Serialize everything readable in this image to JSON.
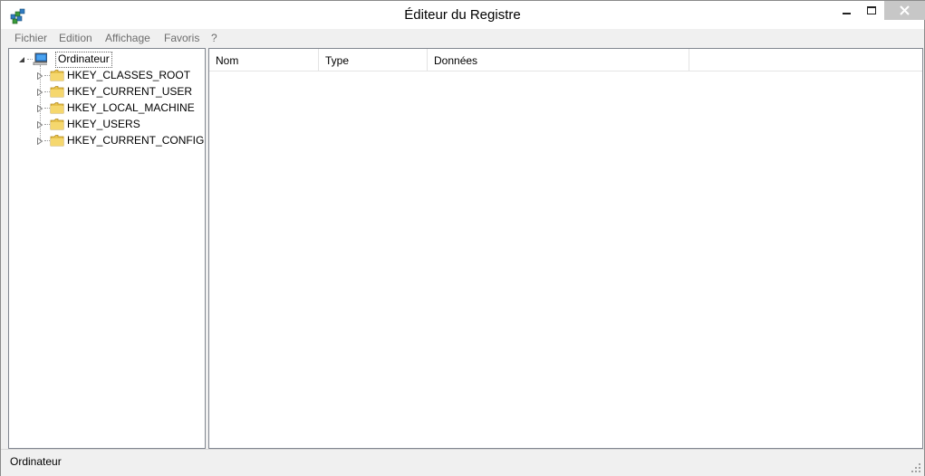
{
  "window": {
    "title": "Éditeur du Registre",
    "icon": "registry-editor-icon",
    "controls": {
      "minimize": "minimize-icon",
      "maximize": "maximize-icon",
      "close": "close-icon"
    }
  },
  "menu": {
    "items": [
      "Fichier",
      "Edition",
      "Affichage",
      "Favoris",
      "?"
    ]
  },
  "tree": {
    "root": {
      "label": "Ordinateur",
      "icon": "computer-icon",
      "expanded": true
    },
    "children": [
      {
        "label": "HKEY_CLASSES_ROOT",
        "icon": "folder-icon"
      },
      {
        "label": "HKEY_CURRENT_USER",
        "icon": "folder-icon"
      },
      {
        "label": "HKEY_LOCAL_MACHINE",
        "icon": "folder-icon"
      },
      {
        "label": "HKEY_USERS",
        "icon": "folder-icon"
      },
      {
        "label": "HKEY_CURRENT_CONFIG",
        "icon": "folder-icon"
      }
    ]
  },
  "list": {
    "columns": [
      "Nom",
      "Type",
      "Données"
    ],
    "rows": []
  },
  "status": {
    "path": "Ordinateur"
  },
  "colors": {
    "titlebar": "#ffffff",
    "chrome": "#f0f0f0",
    "close_button": "#c7c7c7",
    "pane_border": "#828790",
    "menu_text": "#6d6d6d"
  }
}
